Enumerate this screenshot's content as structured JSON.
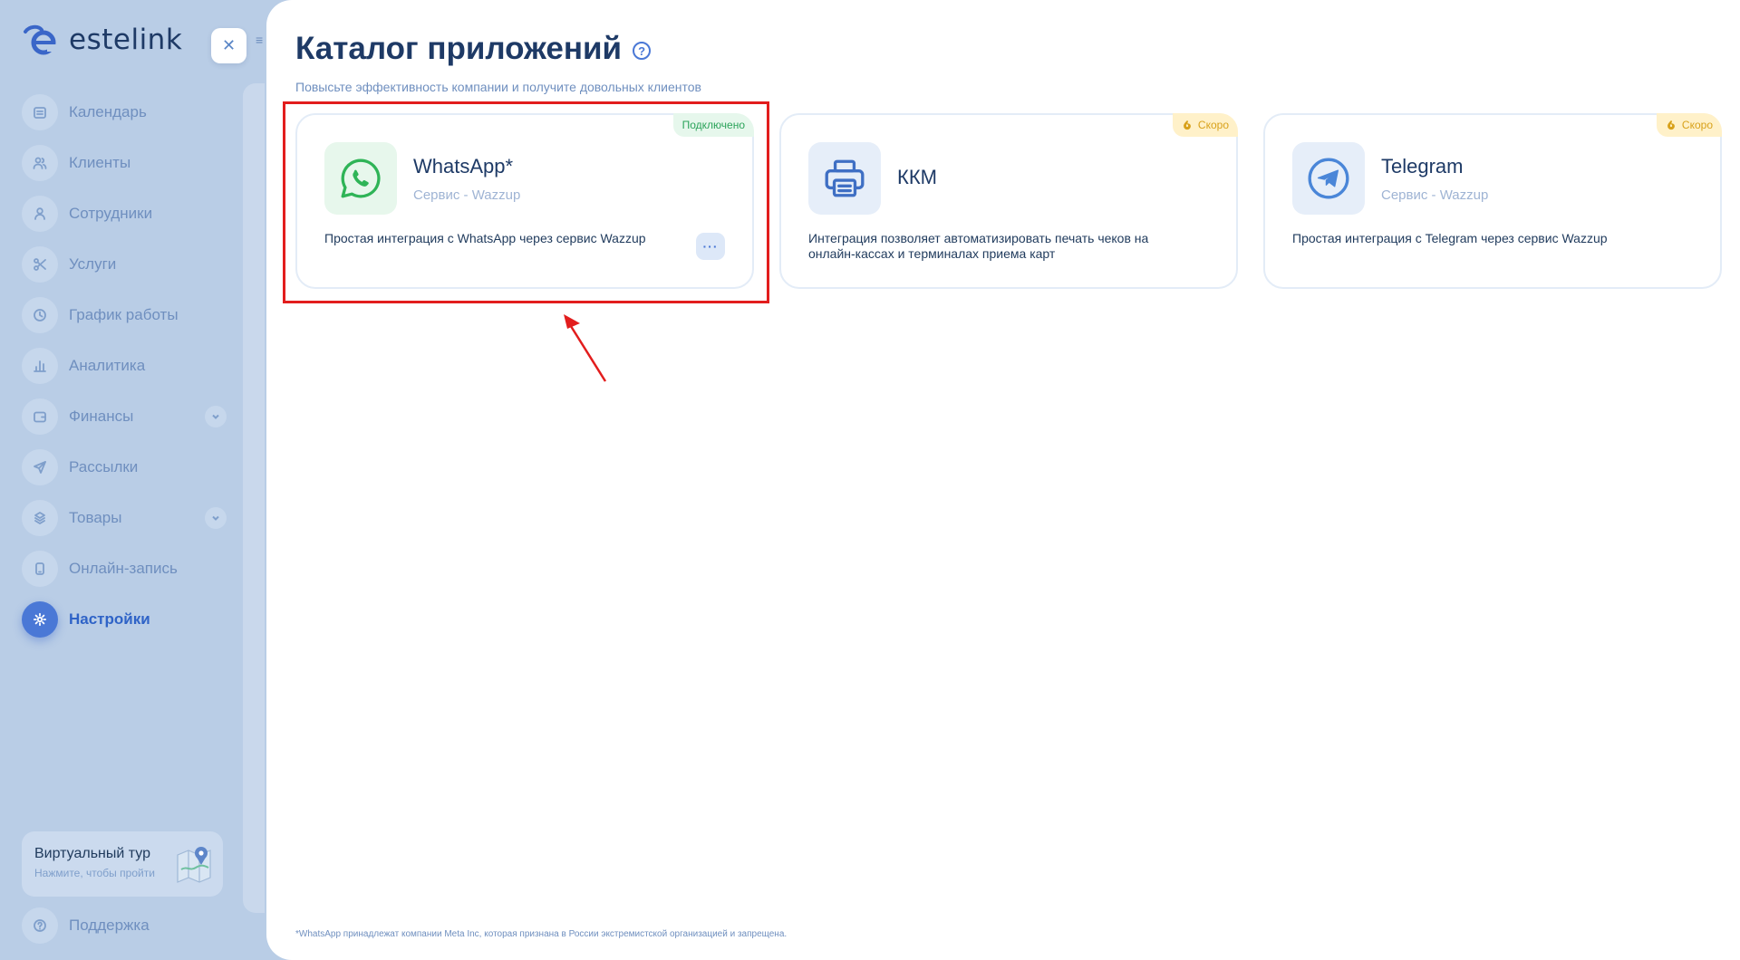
{
  "app": {
    "logo_text": "estelink",
    "close_icon": "close-icon"
  },
  "sidebar": {
    "items": [
      {
        "label": "Календарь",
        "icon": "calendar-icon"
      },
      {
        "label": "Клиенты",
        "icon": "users-icon"
      },
      {
        "label": "Сотрудники",
        "icon": "user-icon"
      },
      {
        "label": "Услуги",
        "icon": "scissors-icon"
      },
      {
        "label": "График работы",
        "icon": "clock-icon"
      },
      {
        "label": "Аналитика",
        "icon": "bar-chart-icon"
      },
      {
        "label": "Финансы",
        "icon": "wallet-icon",
        "expandable": true
      },
      {
        "label": "Рассылки",
        "icon": "send-icon"
      },
      {
        "label": "Товары",
        "icon": "box-icon",
        "expandable": true
      },
      {
        "label": "Онлайн-запись",
        "icon": "phone-icon"
      },
      {
        "label": "Настройки",
        "icon": "gear-icon",
        "active": true
      }
    ],
    "tour": {
      "title": "Виртуальный тур",
      "subtitle": "Нажмите, чтобы пройти"
    },
    "support_label": "Поддержка"
  },
  "main": {
    "title": "Каталог приложений",
    "subtitle": "Повысьте эффективность компании и получите довольных клиентов",
    "cards": [
      {
        "name": "WhatsApp*",
        "vendor": "Сервис - Wazzup",
        "description": "Простая интеграция с WhatsApp через сервис Wazzup",
        "badge": "Подключено",
        "badge_type": "connected",
        "more_label": "···",
        "icon": "whatsapp-icon",
        "accent": "#2fb457"
      },
      {
        "name": "ККМ",
        "vendor": "",
        "description": "Интеграция позволяет автоматизировать печать чеков на онлайн-кассах и терминалах приема карт",
        "badge": "Скоро",
        "badge_type": "soon",
        "icon": "printer-icon",
        "accent": "#3f6fc4"
      },
      {
        "name": "Telegram",
        "vendor": "Сервис - Wazzup",
        "description": "Простая интеграция с Telegram через сервис Wazzup",
        "badge": "Скоро",
        "badge_type": "soon",
        "icon": "telegram-icon",
        "accent": "#4a86d8"
      }
    ],
    "footnote": "*WhatsApp принадлежат компании Meta Inc, которая признана в России экстремистской организацией и запрещена."
  },
  "colors": {
    "sidebar_bg": "#b9cde6",
    "accent": "#4a78d6",
    "highlight": "#e21d1d"
  }
}
